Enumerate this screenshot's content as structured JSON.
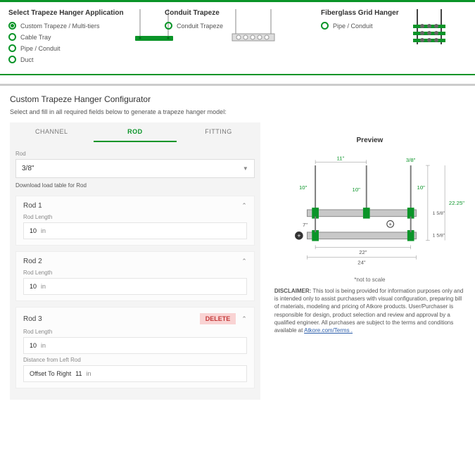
{
  "topSections": {
    "trapeze": {
      "title": "Select Trapeze Hanger Application",
      "options": [
        "Custom Trapeze / Multi-tiers",
        "Cable Tray",
        "Pipe / Conduit",
        "Duct"
      ],
      "selected": 0
    },
    "conduit": {
      "title": "Conduit Trapeze",
      "option": "Conduit Trapeze"
    },
    "fiberglass": {
      "title": "Fiberglass Grid Hanger",
      "option": "Pipe / Conduit"
    }
  },
  "main": {
    "title": "Custom Trapeze Hanger Configurator",
    "sub": "Select and fill in all required fields below to generate a trapeze hanger model:"
  },
  "tabs": {
    "channel": "CHANNEL",
    "rod": "ROD",
    "fitting": "FITTING"
  },
  "rod": {
    "label": "Rod",
    "value": "3/8\"",
    "download": "Download load table for Rod",
    "sections": [
      {
        "title": "Rod 1",
        "lenLabel": "Rod Length",
        "len": "10",
        "unit": "in"
      },
      {
        "title": "Rod 2",
        "lenLabel": "Rod Length",
        "len": "10",
        "unit": "in"
      },
      {
        "title": "Rod 3",
        "lenLabel": "Rod Length",
        "len": "10",
        "unit": "in",
        "delete": "DELETE",
        "distLabel": "Distance from Left Rod",
        "offsetLabel": "Offset To Right",
        "offsetVal": "11",
        "offsetUnit": "in"
      }
    ]
  },
  "preview": {
    "title": "Preview",
    "dims": {
      "top11": "11\"",
      "top38": "3/8\"",
      "left10": "10\"",
      "mid10": "10\"",
      "right10": "10\"",
      "r158a": "1 5/8\"",
      "r158b": "1 5/8\"",
      "r2225": "22.25\"",
      "l7": "7\"",
      "b22": "22\"",
      "b24": "24\""
    },
    "note": "*not to scale"
  },
  "disclaimer": {
    "label": "DISCLAIMER:",
    "text": " This tool is being provided for information purposes only and is intended only to assist purchasers with visual configuration, preparing bill of materials, modeling and pricing of Atkore products. User/Purchaser is responsible for design, product selection and review and approval by a qualified engineer. All purchases are subject to the terms and conditions available at ",
    "link": "Atkore.com/Terms ."
  }
}
